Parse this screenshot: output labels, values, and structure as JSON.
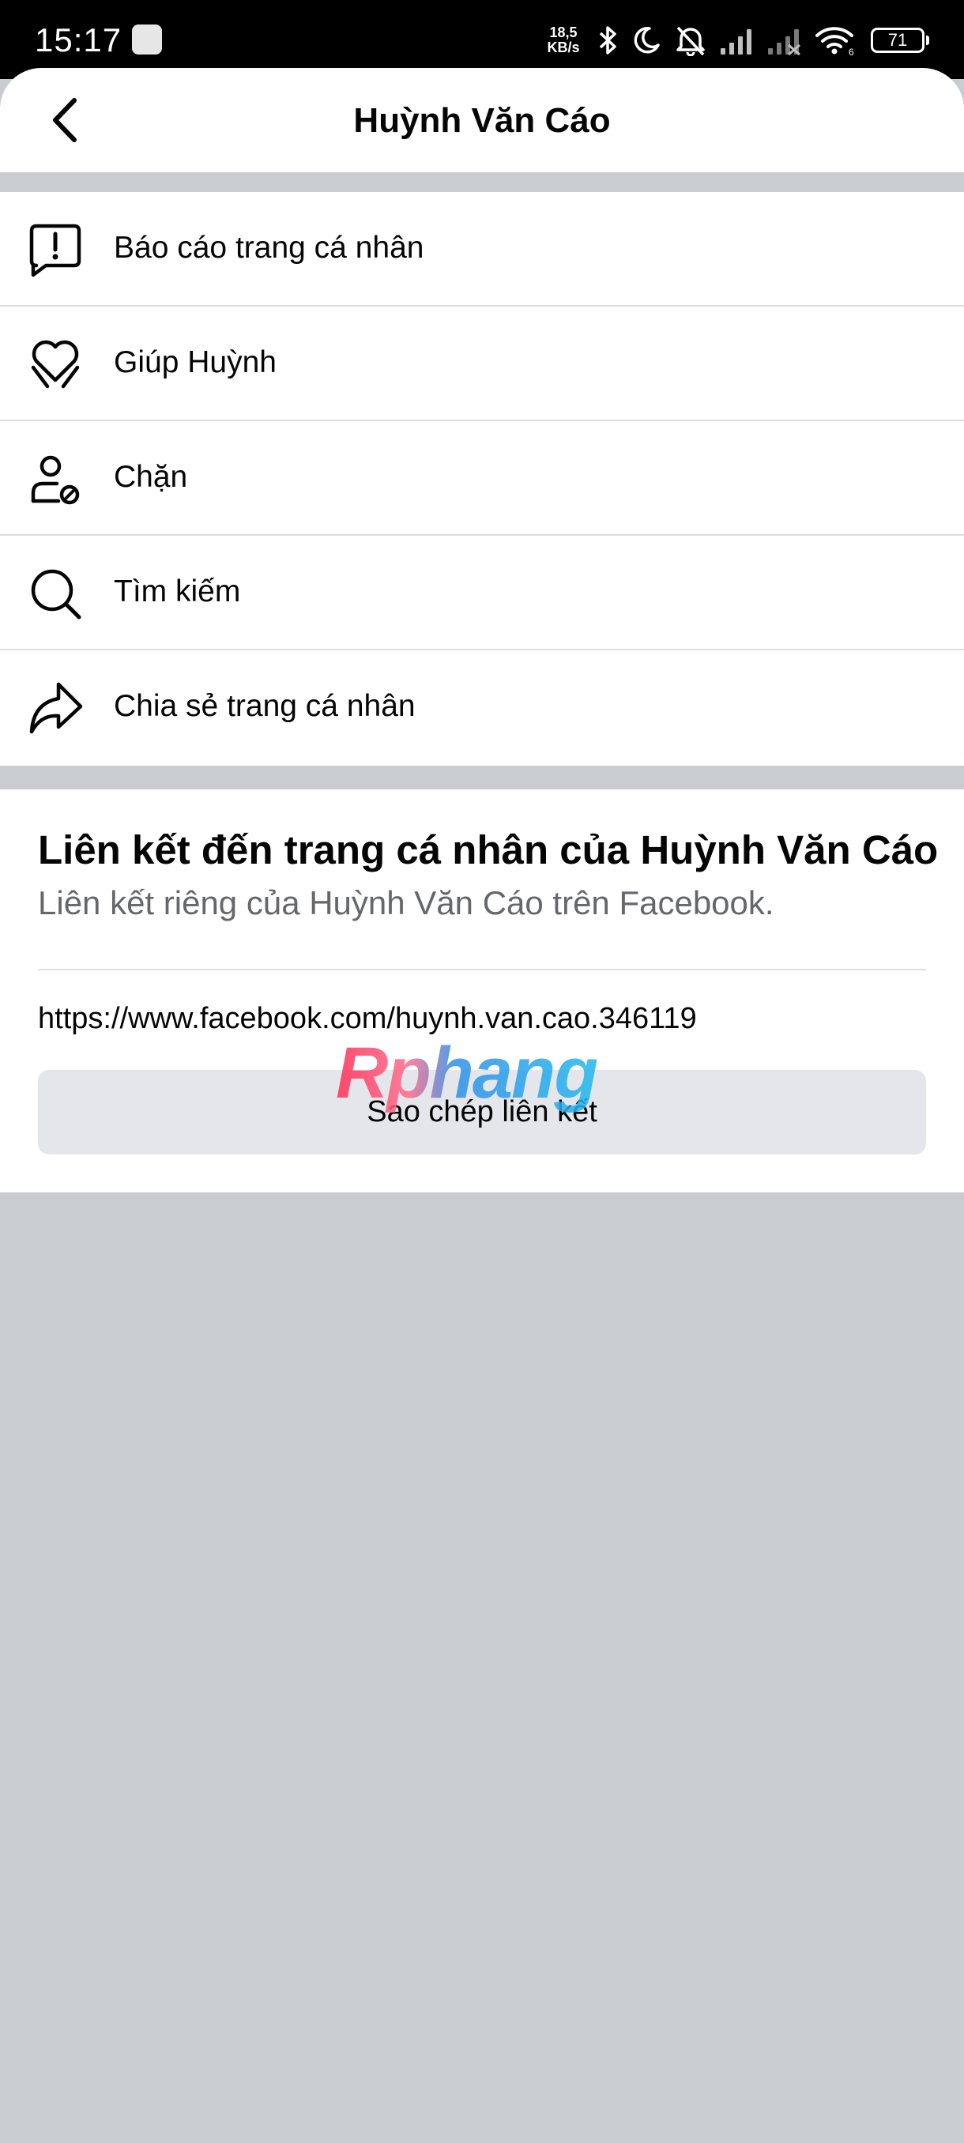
{
  "status_bar": {
    "time": "15:17",
    "net_speed_value": "18,5",
    "net_speed_unit": "KB/s",
    "battery": "71",
    "icons": [
      "app-notification-icon",
      "bluetooth-icon",
      "moon-icon",
      "bell-off-icon",
      "signal-icon",
      "signal-off-icon",
      "wifi-icon",
      "battery-icon"
    ]
  },
  "header": {
    "title": "Huỳnh Văn Cáo",
    "back_icon": "chevron-left-icon"
  },
  "menu": {
    "items": [
      {
        "label": "Báo cáo trang cá nhân",
        "icon": "report-icon"
      },
      {
        "label": "Giúp Huỳnh",
        "icon": "heart-hands-icon"
      },
      {
        "label": "Chặn",
        "icon": "block-user-icon"
      },
      {
        "label": "Tìm kiếm",
        "icon": "search-icon"
      },
      {
        "label": "Chia sẻ trang cá nhân",
        "icon": "share-icon"
      }
    ]
  },
  "link_card": {
    "title": "Liên kết đến trang cá nhân của Huỳnh Văn Cáo",
    "subtitle": "Liên kết riêng của Huỳnh Văn Cáo trên Facebook.",
    "url": "https://www.facebook.com/huynh.van.cao.346119",
    "copy_button": "Sao chép liên kết"
  },
  "watermark": "Rphang",
  "colors": {
    "background": "#c9ccd1",
    "card": "#ffffff",
    "button": "#e4e6eb",
    "secondary_text": "#65676b"
  }
}
